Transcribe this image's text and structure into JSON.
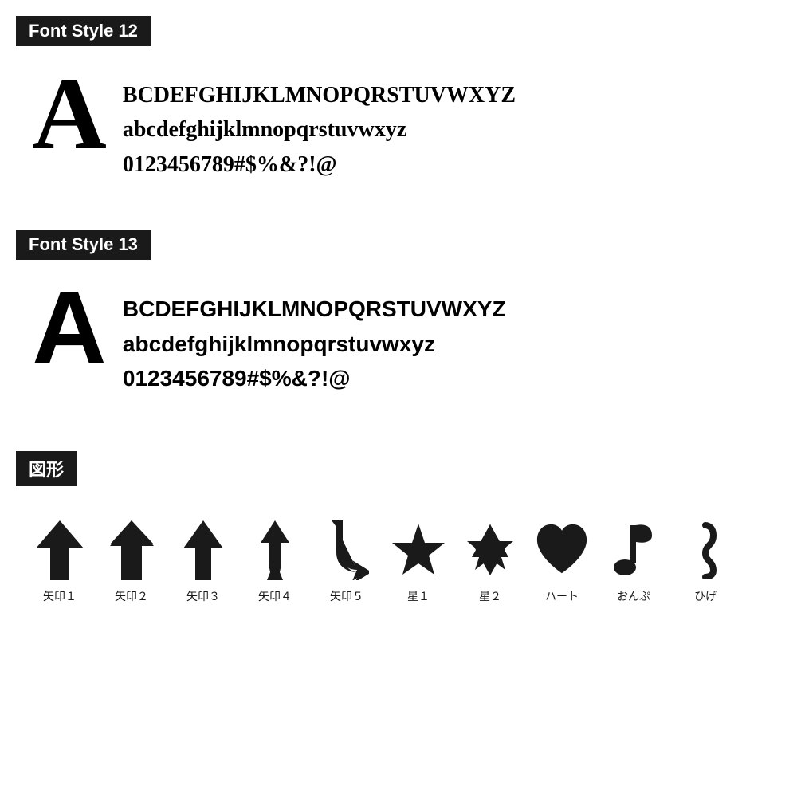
{
  "section12": {
    "header": "Font Style 12",
    "big_letter": "A",
    "line1": "BCDEFGHIJKLMNOPQRSTUVWXYZ",
    "line2": "abcdefghijklmnopqrstuvwxyz",
    "line3": "0123456789#$%&?!@"
  },
  "section13": {
    "header": "Font Style 13",
    "big_letter": "A",
    "line1": "BCDEFGHIJKLMNOPQRSTUVWXYZ",
    "line2": "abcdefghijklmnopqrstuvwxyz",
    "line3": "0123456789#$%&?!@"
  },
  "figures": {
    "header": "図形",
    "items": [
      {
        "label": "矢印１",
        "name": "arrow1"
      },
      {
        "label": "矢印２",
        "name": "arrow2"
      },
      {
        "label": "矢印３",
        "name": "arrow3"
      },
      {
        "label": "矢印４",
        "name": "arrow4"
      },
      {
        "label": "矢印５",
        "name": "arrow5"
      },
      {
        "label": "星１",
        "name": "star1"
      },
      {
        "label": "星２",
        "name": "star2"
      },
      {
        "label": "ハート",
        "name": "heart"
      },
      {
        "label": "おんぷ",
        "name": "music"
      },
      {
        "label": "ひげ",
        "name": "mustache"
      }
    ]
  }
}
